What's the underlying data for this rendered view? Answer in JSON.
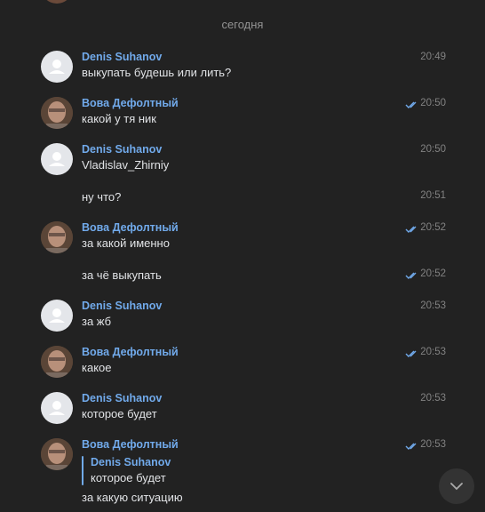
{
  "date_separator": "сегодня",
  "messages": [
    {
      "name": "Denis Suhanov",
      "text": "выкупать будешь или лить?",
      "time": "20:49"
    },
    {
      "name": "Вова Дефолтный",
      "text": "какой у тя ник",
      "time": "20:50"
    },
    {
      "name": "Denis Suhanov",
      "text": "Vladislav_Zhirniy",
      "time": "20:50"
    },
    {
      "text": "ну что?",
      "time": "20:51"
    },
    {
      "name": "Вова Дефолтный",
      "text": "за какой именно",
      "time": "20:52"
    },
    {
      "text": "за чё выкупать",
      "time": "20:52"
    },
    {
      "name": "Denis Suhanov",
      "text": "за жб",
      "time": "20:53"
    },
    {
      "name": "Вова Дефолтный",
      "text": "какое",
      "time": "20:53"
    },
    {
      "name": "Denis Suhanov",
      "text": "которое будет",
      "time": "20:53"
    },
    {
      "name": "Вова Дефолтный",
      "time": "20:53",
      "reply": {
        "name": "Denis Suhanov",
        "text": "которое будет"
      },
      "text": "за какую ситуацию"
    }
  ],
  "colors": {
    "background": "#222222",
    "name": "#71aaeb",
    "text": "#e1e3e6",
    "time": "#828282"
  },
  "icons": {
    "read_check": "double-check-icon",
    "scroll_down": "chevron-down-icon",
    "default_avatar": "user-silhouette-icon"
  }
}
